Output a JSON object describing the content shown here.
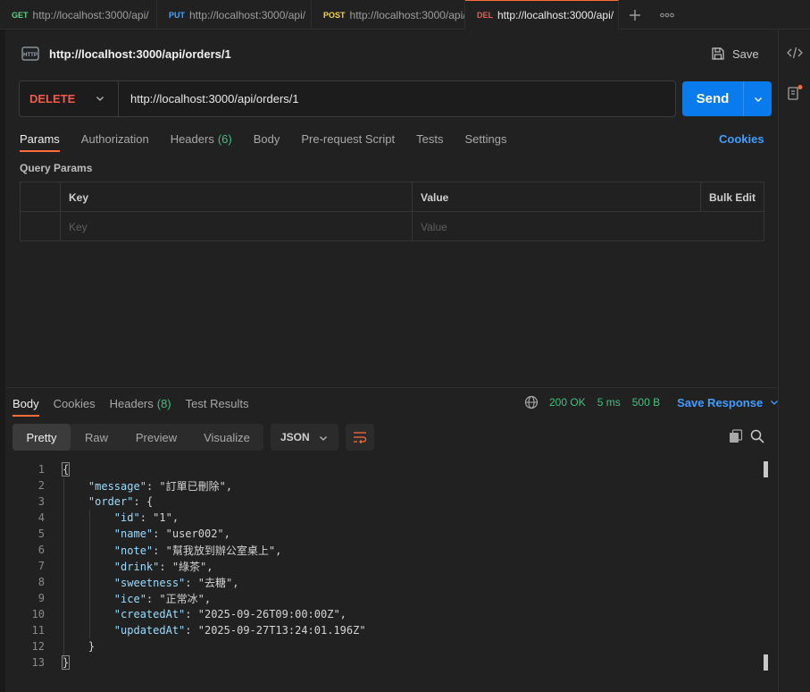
{
  "tabs": [
    {
      "method": "GET",
      "method_color": "#5fd08a",
      "url": "http://localhost:3000/api/",
      "active": false
    },
    {
      "method": "PUT",
      "method_color": "#4fa3f7",
      "url": "http://localhost:3000/api/",
      "active": false
    },
    {
      "method": "POST",
      "method_color": "#f5d547",
      "url": "http://localhost:3000/api/",
      "active": false
    },
    {
      "method": "DEL",
      "method_color": "#f15b4f",
      "url": "http://localhost:3000/api/",
      "active": true
    }
  ],
  "request": {
    "title": "http://localhost:3000/api/orders/1",
    "save_label": "Save",
    "method": "DELETE",
    "url": "http://localhost:3000/api/orders/1",
    "send_label": "Send"
  },
  "request_tabs": [
    {
      "label": "Params",
      "count": ""
    },
    {
      "label": "Authorization",
      "count": ""
    },
    {
      "label": "Headers",
      "count": "(6)"
    },
    {
      "label": "Body",
      "count": ""
    },
    {
      "label": "Pre-request Script",
      "count": ""
    },
    {
      "label": "Tests",
      "count": ""
    },
    {
      "label": "Settings",
      "count": ""
    }
  ],
  "cookies_label": "Cookies",
  "query_params": {
    "label": "Query Params",
    "headers": {
      "key": "Key",
      "value": "Value",
      "bulk": "Bulk Edit"
    },
    "placeholders": {
      "key": "Key",
      "value": "Value"
    }
  },
  "response_tabs": [
    {
      "label": "Body",
      "count": ""
    },
    {
      "label": "Cookies",
      "count": ""
    },
    {
      "label": "Headers",
      "count": "(8)"
    },
    {
      "label": "Test Results",
      "count": ""
    }
  ],
  "status": {
    "code": "200 OK",
    "time": "5 ms",
    "size": "500 B",
    "save_response": "Save Response"
  },
  "format_tabs": [
    "Pretty",
    "Raw",
    "Preview",
    "Visualize"
  ],
  "format_select": "JSON",
  "code_lines": [
    {
      "n": "1",
      "text": "{"
    },
    {
      "n": "2",
      "text": "    \"message\": \"訂單已刪除\","
    },
    {
      "n": "3",
      "text": "    \"order\": {"
    },
    {
      "n": "4",
      "text": "        \"id\": \"1\","
    },
    {
      "n": "5",
      "text": "        \"name\": \"user002\","
    },
    {
      "n": "6",
      "text": "        \"note\": \"幫我放到辦公室桌上\","
    },
    {
      "n": "7",
      "text": "        \"drink\": \"綠茶\","
    },
    {
      "n": "8",
      "text": "        \"sweetness\": \"去糖\","
    },
    {
      "n": "9",
      "text": "        \"ice\": \"正常冰\","
    },
    {
      "n": "10",
      "text": "        \"createdAt\": \"2025-09-26T09:00:00Z\","
    },
    {
      "n": "11",
      "text": "        \"updatedAt\": \"2025-09-27T13:24:01.196Z\""
    },
    {
      "n": "12",
      "text": "    }"
    },
    {
      "n": "13",
      "text": "}"
    }
  ],
  "colors": {
    "accent": "#ff6c37",
    "send": "#097bed",
    "delete": "#f15b4f",
    "success": "#3fc27e",
    "link": "#3f9eff"
  }
}
